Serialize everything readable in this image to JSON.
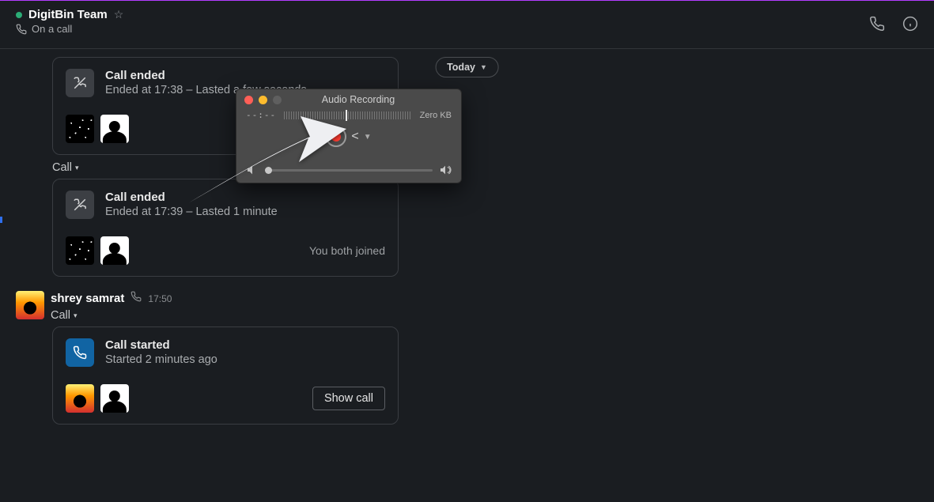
{
  "header": {
    "channel_name": "DigitBin Team",
    "status_text": "On a call"
  },
  "today_label": "Today",
  "cards": [
    {
      "title": "Call ended",
      "subtitle": "Ended at 17:38 – Lasted a few seconds",
      "joined_text": ""
    },
    {
      "title": "Call ended",
      "subtitle": "Ended at 17:39 – Lasted 1 minute",
      "joined_text": "You both joined"
    },
    {
      "title": "Call started",
      "subtitle": "Started 2 minutes ago",
      "show_call_label": "Show call"
    }
  ],
  "call_dropdown_label": "Call",
  "message": {
    "author": "shrey samrat",
    "time": "17:50"
  },
  "recording": {
    "window_title": "Audio Recording",
    "time": "--:--",
    "size": "Zero KB"
  }
}
